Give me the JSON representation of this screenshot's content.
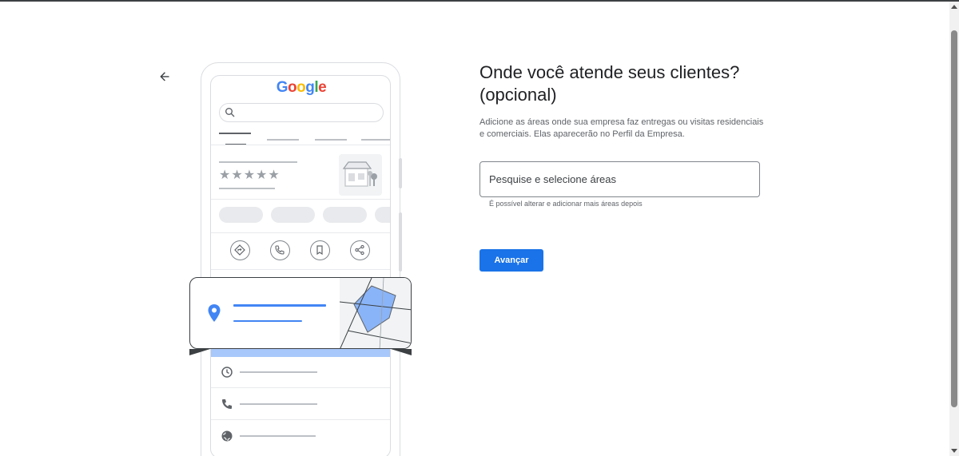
{
  "header": {
    "back_icon": "arrow-left-icon"
  },
  "illustration": {
    "logo_text": "Google",
    "logo_colors": [
      "#4285F4",
      "#EA4335",
      "#FBBC05",
      "#4285F4",
      "#34A853",
      "#EA4335"
    ],
    "stars": "★★★★★",
    "icons": [
      "search-icon",
      "store-icon",
      "directions-icon",
      "phone-icon",
      "bookmark-icon",
      "share-icon",
      "location-pin-icon",
      "clock-icon",
      "phone-icon",
      "globe-icon"
    ]
  },
  "main": {
    "title": "Onde você atende seus clientes? (opcional)",
    "description": "Adicione as áreas onde sua empresa faz entregas ou visitas residenciais e comerciais. Elas aparecerão no Perfil da Empresa.",
    "search": {
      "placeholder": "Pesquise e selecione áreas",
      "value": ""
    },
    "helper_text": "É possível alterar e adicionar mais áreas depois",
    "next_label": "Avançar"
  },
  "colors": {
    "accent": "#1a73e8",
    "map_polygon": "#8ab4f8",
    "pin": "#4285f4"
  }
}
